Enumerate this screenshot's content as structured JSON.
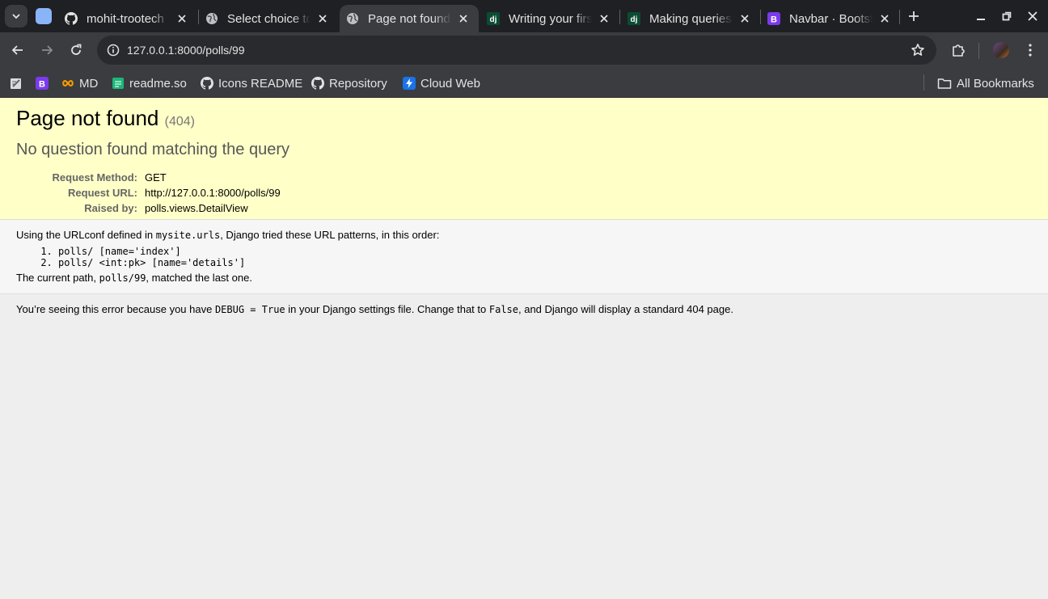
{
  "browser": {
    "tabs": [
      {
        "title": "mohit-trootech",
        "icon": "github-icon",
        "active": false
      },
      {
        "title": "Select choice to",
        "icon": "globe-icon",
        "active": false
      },
      {
        "title": "Page not found",
        "icon": "globe-icon",
        "active": true
      },
      {
        "title": "Writing your first",
        "icon": "django-icon",
        "active": false
      },
      {
        "title": "Making queries",
        "icon": "django-icon",
        "active": false
      },
      {
        "title": "Navbar · Bootstrap",
        "icon": "bootstrap-icon",
        "active": false
      }
    ],
    "favicon_letters": {
      "django": "dj",
      "bootstrap": "B"
    },
    "address": "127.0.0.1:8000/polls/99",
    "bookmarks": [
      {
        "label": "",
        "icon": "notes-icon"
      },
      {
        "label": "",
        "icon": "bootstrap-icon",
        "letter": "B"
      },
      {
        "label": "MD",
        "icon": "infinity-icon"
      },
      {
        "label": "readme.so",
        "icon": "readme-icon"
      },
      {
        "label": "Icons README",
        "icon": "github-icon"
      },
      {
        "label": "Repository",
        "icon": "github-icon"
      },
      {
        "label": "Cloud Web",
        "icon": "bolt-icon"
      }
    ],
    "all_bookmarks": "All Bookmarks",
    "colors": {
      "tab_strip": "#1f2023",
      "toolbar": "#3b3c40",
      "summary_bg": "#ffffc8",
      "info_bg": "#f6f6f6",
      "bootstrap_purple": "#7c3aed",
      "django_green": "#0c4b33"
    }
  },
  "page": {
    "title": "Page not found",
    "code": "(404)",
    "subtitle": "No question found matching the query",
    "meta": [
      {
        "label": "Request Method:",
        "value": "GET"
      },
      {
        "label": "Request URL:",
        "value": "http://127.0.0.1:8000/polls/99"
      },
      {
        "label": "Raised by:",
        "value": "polls.views.DetailView"
      }
    ],
    "info": {
      "intro_pre": "Using the URLconf defined in ",
      "intro_code": "mysite.urls",
      "intro_post": ", Django tried these URL patterns, in this order:",
      "patterns": [
        "polls/ [name='index']",
        "polls/ <int:pk> [name='details']"
      ],
      "current_pre": "The current path, ",
      "current_code": "polls/99",
      "current_post": ", matched the last one."
    },
    "explanation": {
      "pre": "You’re seeing this error because you have ",
      "code1": "DEBUG = True",
      "mid": " in your Django settings file. Change that to ",
      "code2": "False",
      "post": ", and Django will display a standard 404 page."
    }
  }
}
